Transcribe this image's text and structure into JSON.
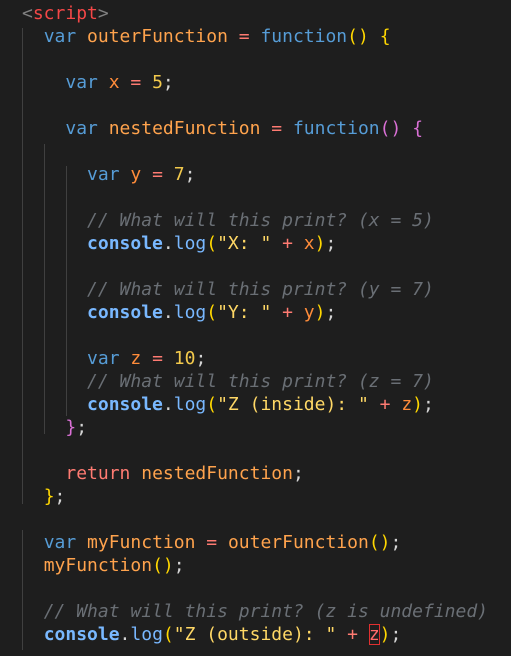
{
  "editor": {
    "language": "javascript",
    "lines": [
      [
        {
          "t": "<",
          "c": "brk"
        },
        {
          "t": "script",
          "c": "tag"
        },
        {
          "t": ">",
          "c": "brk"
        }
      ],
      [
        {
          "t": "  "
        },
        {
          "t": "var",
          "c": "kw"
        },
        {
          "t": " "
        },
        {
          "t": "outerFunction",
          "c": "fn"
        },
        {
          "t": " = ",
          "c": "op"
        },
        {
          "t": "function",
          "c": "kw"
        },
        {
          "t": "()",
          "c": "bracket"
        },
        {
          "t": " "
        },
        {
          "t": "{",
          "c": "bracket"
        }
      ],
      [],
      [
        {
          "t": "    "
        },
        {
          "t": "var",
          "c": "kw"
        },
        {
          "t": " "
        },
        {
          "t": "x",
          "c": "var"
        },
        {
          "t": " = ",
          "c": "op"
        },
        {
          "t": "5",
          "c": "num"
        },
        {
          "t": ";",
          "c": "punc"
        }
      ],
      [],
      [
        {
          "t": "    "
        },
        {
          "t": "var",
          "c": "kw"
        },
        {
          "t": " "
        },
        {
          "t": "nestedFunction",
          "c": "fn"
        },
        {
          "t": " = ",
          "c": "op"
        },
        {
          "t": "function",
          "c": "kw"
        },
        {
          "t": "()",
          "c": "bracket2"
        },
        {
          "t": " "
        },
        {
          "t": "{",
          "c": "bracket2"
        }
      ],
      [],
      [
        {
          "t": "      "
        },
        {
          "t": "var",
          "c": "kw"
        },
        {
          "t": " "
        },
        {
          "t": "y",
          "c": "var"
        },
        {
          "t": " = ",
          "c": "op"
        },
        {
          "t": "7",
          "c": "num"
        },
        {
          "t": ";",
          "c": "punc"
        }
      ],
      [],
      [
        {
          "t": "      "
        },
        {
          "t": "// What will this print? (x = 5)",
          "c": "cm"
        }
      ],
      [
        {
          "t": "      "
        },
        {
          "t": "console",
          "c": "console"
        },
        {
          "t": ".",
          "c": "punc"
        },
        {
          "t": "log",
          "c": "method"
        },
        {
          "t": "(",
          "c": "bracket"
        },
        {
          "t": "\"X: \"",
          "c": "str"
        },
        {
          "t": " + ",
          "c": "op"
        },
        {
          "t": "x",
          "c": "var"
        },
        {
          "t": ")",
          "c": "bracket"
        },
        {
          "t": ";",
          "c": "punc"
        }
      ],
      [],
      [
        {
          "t": "      "
        },
        {
          "t": "// What will this print? (y = 7)",
          "c": "cm"
        }
      ],
      [
        {
          "t": "      "
        },
        {
          "t": "console",
          "c": "console"
        },
        {
          "t": ".",
          "c": "punc"
        },
        {
          "t": "log",
          "c": "method"
        },
        {
          "t": "(",
          "c": "bracket"
        },
        {
          "t": "\"Y: \"",
          "c": "str"
        },
        {
          "t": " + ",
          "c": "op"
        },
        {
          "t": "y",
          "c": "var"
        },
        {
          "t": ")",
          "c": "bracket"
        },
        {
          "t": ";",
          "c": "punc"
        }
      ],
      [],
      [
        {
          "t": "      "
        },
        {
          "t": "var",
          "c": "kw"
        },
        {
          "t": " "
        },
        {
          "t": "z",
          "c": "var"
        },
        {
          "t": " = ",
          "c": "op"
        },
        {
          "t": "10",
          "c": "num"
        },
        {
          "t": ";",
          "c": "punc"
        }
      ],
      [
        {
          "t": "      "
        },
        {
          "t": "// What will this print? (z = 7)",
          "c": "cm"
        }
      ],
      [
        {
          "t": "      "
        },
        {
          "t": "console",
          "c": "console"
        },
        {
          "t": ".",
          "c": "punc"
        },
        {
          "t": "log",
          "c": "method"
        },
        {
          "t": "(",
          "c": "bracket"
        },
        {
          "t": "\"Z (inside): \"",
          "c": "str"
        },
        {
          "t": " + ",
          "c": "op"
        },
        {
          "t": "z",
          "c": "var"
        },
        {
          "t": ")",
          "c": "bracket"
        },
        {
          "t": ";",
          "c": "punc"
        }
      ],
      [
        {
          "t": "    "
        },
        {
          "t": "}",
          "c": "bracket2"
        },
        {
          "t": ";",
          "c": "punc"
        }
      ],
      [],
      [
        {
          "t": "    "
        },
        {
          "t": "return",
          "c": "ret"
        },
        {
          "t": " "
        },
        {
          "t": "nestedFunction",
          "c": "fn"
        },
        {
          "t": ";",
          "c": "punc"
        }
      ],
      [
        {
          "t": "  "
        },
        {
          "t": "}",
          "c": "bracket"
        },
        {
          "t": ";",
          "c": "punc"
        }
      ],
      [],
      [
        {
          "t": "  "
        },
        {
          "t": "var",
          "c": "kw"
        },
        {
          "t": " "
        },
        {
          "t": "myFunction",
          "c": "fn"
        },
        {
          "t": " = ",
          "c": "op"
        },
        {
          "t": "outerFunction",
          "c": "fn"
        },
        {
          "t": "()",
          "c": "bracket"
        },
        {
          "t": ";",
          "c": "punc"
        }
      ],
      [
        {
          "t": "  "
        },
        {
          "t": "myFunction",
          "c": "fn"
        },
        {
          "t": "()",
          "c": "bracket"
        },
        {
          "t": ";",
          "c": "punc"
        }
      ],
      [],
      [
        {
          "t": "  "
        },
        {
          "t": "// What will this print? (z is undefined)",
          "c": "cm"
        }
      ],
      [
        {
          "t": "  "
        },
        {
          "t": "console",
          "c": "console"
        },
        {
          "t": ".",
          "c": "punc"
        },
        {
          "t": "log",
          "c": "method"
        },
        {
          "t": "(",
          "c": "bracket"
        },
        {
          "t": "\"Z (outside): \"",
          "c": "str"
        },
        {
          "t": " + ",
          "c": "op"
        },
        {
          "t": "z",
          "c": "err"
        },
        {
          "t": ")",
          "c": "bracket"
        },
        {
          "t": ";",
          "c": "punc"
        }
      ]
    ],
    "error_highlight": {
      "token": "z",
      "color": "#e03030"
    },
    "colors": {
      "background": "#1e1e1e",
      "keyword": "#569cd6",
      "variable": "#ff8c3a",
      "function_name": "#ffa34d",
      "number": "#f2c94c",
      "string": "#ffd866",
      "comment": "#6a6f75",
      "console": "#79b8ff",
      "tag": "#f44747"
    }
  }
}
